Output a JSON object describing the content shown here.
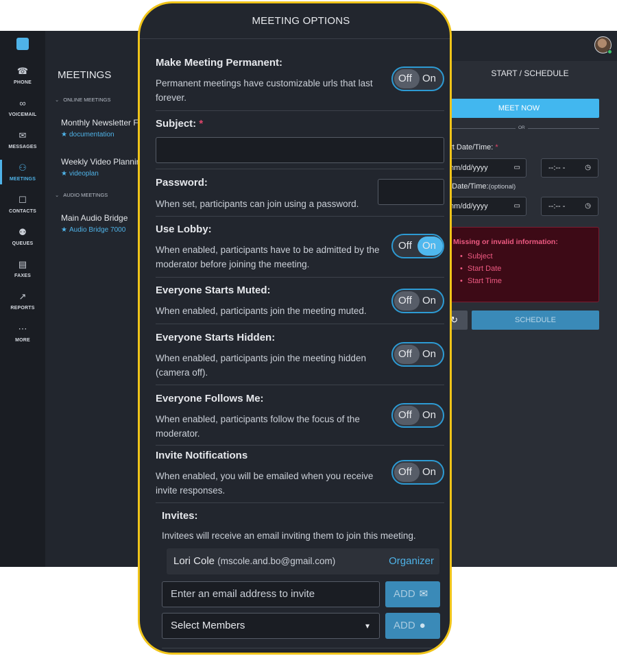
{
  "nav": {
    "items": [
      {
        "label": "PHONE",
        "icon": "phone-icon",
        "glyph": "☎"
      },
      {
        "label": "VOICEMAIL",
        "icon": "voicemail-icon",
        "glyph": "∞"
      },
      {
        "label": "MESSAGES",
        "icon": "messages-icon",
        "glyph": "✉"
      },
      {
        "label": "MEETINGS",
        "icon": "meetings-icon",
        "glyph": "⚇"
      },
      {
        "label": "CONTACTS",
        "icon": "contacts-icon",
        "glyph": "☐"
      },
      {
        "label": "QUEUES",
        "icon": "queues-icon",
        "glyph": "⚉"
      },
      {
        "label": "FAXES",
        "icon": "faxes-icon",
        "glyph": "▤"
      },
      {
        "label": "REPORTS",
        "icon": "reports-icon",
        "glyph": "↗"
      },
      {
        "label": "MORE",
        "icon": "more-icon",
        "glyph": "⋯"
      }
    ],
    "active": "MEETINGS",
    "accent": "#4fb3e8"
  },
  "meetings": {
    "title": "MEETINGS",
    "online_header": "ONLINE MEETINGS",
    "audio_header": "AUDIO MEETINGS",
    "online": [
      {
        "title": "Monthly Newsletter F",
        "sub": "documentation"
      },
      {
        "title": "Weekly Video Plannin",
        "sub": "videoplan"
      }
    ],
    "audio": [
      {
        "title": "Main Audio Bridge",
        "sub": "Audio Bridge 7000"
      }
    ]
  },
  "schedule": {
    "title": "START / SCHEDULE",
    "meet_now": "MEET NOW",
    "or": "OR",
    "start_label": "art Date/Time:",
    "end_label": "d Date/Time:",
    "end_optional": "(optional)",
    "date_placeholder": "mm/dd/yyyy",
    "time_placeholder": "--:-- -",
    "error_title": "Missing or invalid information:",
    "errors": [
      "Subject",
      "Start Date",
      "Start Time"
    ],
    "schedule_btn": "SCHEDULE",
    "error_color": "#ef5a82"
  },
  "modal": {
    "title": "MEETING OPTIONS",
    "permanent": {
      "title": "Make Meeting Permanent:",
      "desc": "Permanent meetings have customizable urls that last forever.",
      "state": "off"
    },
    "subject": {
      "title": "Subject:",
      "required": "*",
      "value": ""
    },
    "password": {
      "title": "Password:",
      "desc": "When set, participants can join using a password.",
      "value": ""
    },
    "lobby": {
      "title": "Use Lobby:",
      "desc": "When enabled, participants have to be admitted by the moderator before joining the meeting.",
      "state": "on"
    },
    "muted": {
      "title": "Everyone Starts Muted:",
      "desc": "When enabled, participants join the meeting muted.",
      "state": "off"
    },
    "hidden": {
      "title": "Everyone Starts Hidden:",
      "desc": "When enabled, participants join the meeting hidden (camera off).",
      "state": "off"
    },
    "follows": {
      "title": "Everyone Follows Me:",
      "desc": "When enabled, participants follow the focus of the moderator.",
      "state": "off"
    },
    "notifications": {
      "title": "Invite Notifications",
      "desc": "When enabled, you will be emailed when you receive invite responses.",
      "state": "off"
    },
    "toggle": {
      "off": "Off",
      "on": "On"
    },
    "invites": {
      "title": "Invites:",
      "desc": "Invitees will receive an email inviting them to join this meeting.",
      "organizer_name": "Lori Cole",
      "organizer_email": "(mscole.and.bo@gmail.com)",
      "organizer_role": "Organizer",
      "email_placeholder": "Enter an email address to invite",
      "members_placeholder": "Select Members",
      "add_label": "ADD"
    },
    "border_color": "#f0c419"
  }
}
